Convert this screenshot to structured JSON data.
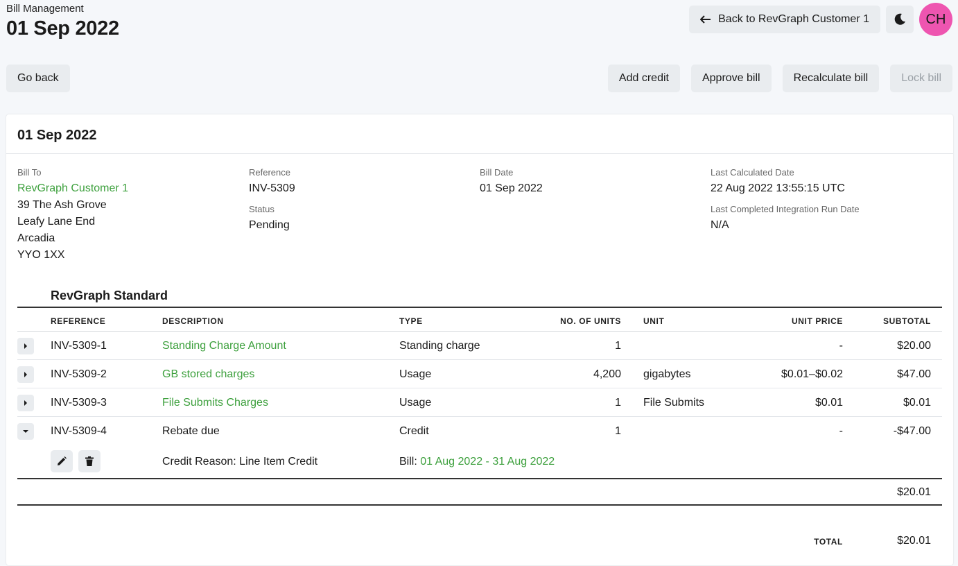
{
  "header": {
    "subtitle": "Bill Management",
    "title": "01 Sep 2022"
  },
  "top_actions": {
    "back_label": "Back to RevGraph Customer 1",
    "avatar_initials": "CH",
    "avatar_color": "#ee55b0"
  },
  "actions": {
    "go_back": "Go back",
    "add_credit": "Add credit",
    "approve_bill": "Approve bill",
    "recalculate_bill": "Recalculate bill",
    "lock_bill": "Lock bill"
  },
  "card": {
    "title": "01 Sep 2022",
    "bill_to": {
      "label": "Bill To",
      "customer": "RevGraph Customer 1",
      "address": [
        "39 The Ash Grove",
        "Leafy Lane End",
        "Arcadia",
        "YYO 1XX"
      ]
    },
    "reference": {
      "label": "Reference",
      "value": "INV-5309"
    },
    "status": {
      "label": "Status",
      "value": "Pending"
    },
    "bill_date": {
      "label": "Bill Date",
      "value": "01 Sep 2022"
    },
    "last_calculated": {
      "label": "Last Calculated Date",
      "value": "22 Aug 2022 13:55:15 UTC"
    },
    "last_integration": {
      "label": "Last Completed Integration Run Date",
      "value": "N/A"
    }
  },
  "table": {
    "section_title": "RevGraph Standard",
    "headers": {
      "reference": "REFERENCE",
      "description": "DESCRIPTION",
      "type": "TYPE",
      "units": "NO. OF UNITS",
      "unit": "UNIT",
      "unit_price": "UNIT PRICE",
      "subtotal": "SUBTOTAL"
    },
    "rows": [
      {
        "reference": "INV-5309-1",
        "description": "Standing Charge Amount",
        "type": "Standing charge",
        "units": "1",
        "unit": "",
        "unit_price": "-",
        "subtotal": "$20.00"
      },
      {
        "reference": "INV-5309-2",
        "description": "GB stored charges",
        "type": "Usage",
        "units": "4,200",
        "unit": "gigabytes",
        "unit_price": "$0.01–$0.02",
        "subtotal": "$47.00"
      },
      {
        "reference": "INV-5309-3",
        "description": "File Submits Charges",
        "type": "Usage",
        "units": "1",
        "unit": "File Submits",
        "unit_price": "$0.01",
        "subtotal": "$0.01"
      },
      {
        "reference": "INV-5309-4",
        "description": "Rebate due",
        "type": "Credit",
        "units": "1",
        "unit": "",
        "unit_price": "-",
        "subtotal": "-$47.00"
      }
    ],
    "detail": {
      "credit_reason": "Credit Reason: Line Item Credit",
      "bill_prefix": "Bill:",
      "bill_range": "01 Aug 2022 - 31 Aug 2022"
    },
    "section_subtotal": "$20.01",
    "total_label": "TOTAL",
    "total_value": "$20.01"
  },
  "colors": {
    "link_green": "#3da03d",
    "button_bg": "#e9ecef",
    "page_bg": "#f5f7fa"
  }
}
